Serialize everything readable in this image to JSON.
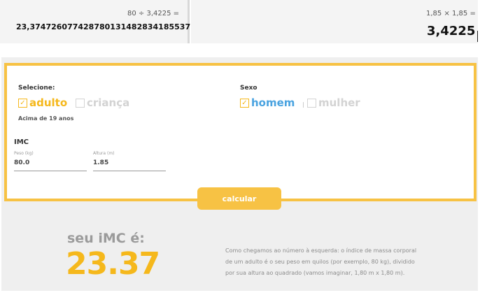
{
  "calculator_left": {
    "expression": "80 ÷ 3,4225 =",
    "result": "23,374726077428780131482834185537"
  },
  "calculator_right": {
    "expression": "1,85 × 1,85 =",
    "result": "3,4225"
  },
  "form": {
    "select_label": "Selecione:",
    "age_options": [
      {
        "label": "adulto",
        "checked": true
      },
      {
        "label": "criança",
        "checked": false
      }
    ],
    "age_note": "Acima de 19 anos",
    "sex_label": "Sexo",
    "sex_options": [
      {
        "label": "homem",
        "checked": true
      },
      {
        "label": "mulher",
        "checked": false
      }
    ],
    "imc_title": "IMC",
    "weight_label": "Peso (kg)",
    "weight_value": "80.0",
    "height_label": "Altura (m)",
    "height_value": "1.85",
    "calc_button": "calcular"
  },
  "result": {
    "label": "seu iMC é:",
    "value": "23.37",
    "explanation": "Como chegamos ao número à esquerda: o índice de massa corporal de um adulto é o seu peso em quilos (por exemplo, 80 kg), dividido por sua altura ao quadrado (vamos imaginar, 1,80 m x 1,80 m)."
  },
  "colors": {
    "accent": "#f7c244",
    "accent_text": "#f5b81c",
    "blue": "#4aa3e0",
    "inactive": "#d3d3d3"
  }
}
